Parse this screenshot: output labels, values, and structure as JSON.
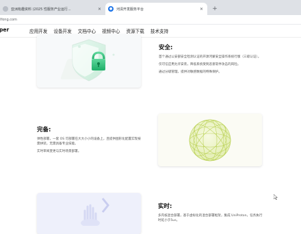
{
  "browser": {
    "tabs": [
      {
        "title": "亚洲有趣资料 (2025 性服务产业运行..."
      },
      {
        "title": "河清开发服务平台"
      }
    ],
    "url": "Ifong.com"
  },
  "site": {
    "brand": "per",
    "nav": [
      "应用开发",
      "设备开发",
      "文档中心",
      "视频中心",
      "资源下载",
      "技术支持"
    ]
  },
  "sections": {
    "security": {
      "title": "安全:",
      "paragraphs": [
        "首个通过公安部安全检测认证的开源河蒙安全操作系统行版（三级认证）。",
        "仅可信应用允许安装，降低系统受到恶意软件攻击的风险。",
        "通过分级管理，提供对敏感数据的特殊保护。"
      ]
    },
    "complete": {
      "title": "完备:",
      "paragraphs": [
        "弹性部署，一套 OS 可部署在大大小小的设备上，且提供图形化配置实现按需拼装，无需具备专业技能。",
        "实时审阅变更与实时场景部署。"
      ]
    },
    "realtime": {
      "title": "实时:",
      "paragraphs": [
        "多内核混合部署，基于虚拟化的混合部署框架，集成 UniProton，任务执行时延小于5us。"
      ]
    }
  },
  "colors": {
    "shield_green": "#27c17a",
    "globe_yellow": "#d6e98a"
  }
}
